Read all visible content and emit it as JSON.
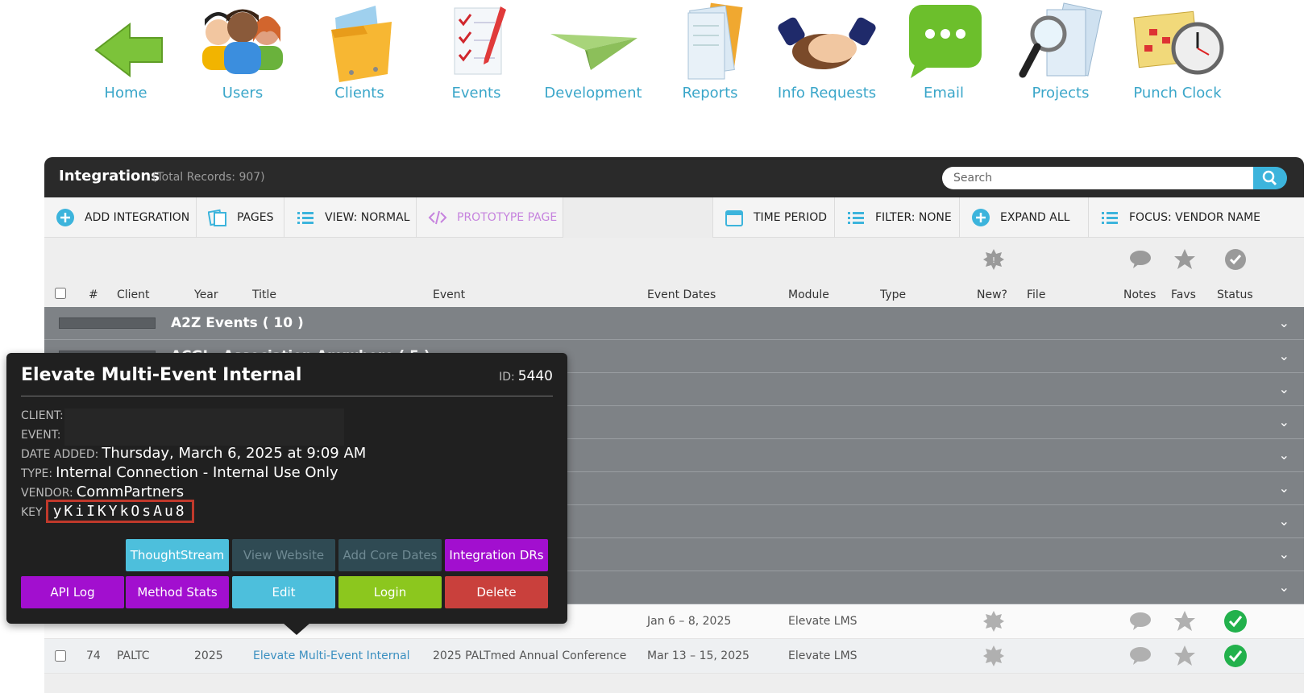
{
  "nav": [
    {
      "label": "Home",
      "icon": "home-arrow-icon"
    },
    {
      "label": "Users",
      "icon": "users-icon"
    },
    {
      "label": "Clients",
      "icon": "folder-icon"
    },
    {
      "label": "Events",
      "icon": "checklist-icon"
    },
    {
      "label": "Development",
      "icon": "paper-plane-icon"
    },
    {
      "label": "Reports",
      "icon": "documents-icon"
    },
    {
      "label": "Info Requests",
      "icon": "handshake-icon"
    },
    {
      "label": "Email",
      "icon": "chat-bubble-icon"
    },
    {
      "label": "Projects",
      "icon": "magnifier-icon"
    },
    {
      "label": "Punch Clock",
      "icon": "calendar-clock-icon"
    }
  ],
  "panel": {
    "title": "Integrations",
    "subtitle": "(Total Records: 907)",
    "search_placeholder": "Search"
  },
  "toolbar": {
    "add": "ADD INTEGRATION",
    "pages": "PAGES",
    "view": "VIEW: NORMAL",
    "prototype": "PROTOTYPE PAGE",
    "time": "TIME PERIOD",
    "filter": "FILTER: NONE",
    "expand": "EXPAND ALL",
    "focus": "FOCUS: VENDOR NAME"
  },
  "columns": {
    "num": "#",
    "client": "Client",
    "year": "Year",
    "title": "Title",
    "event": "Event",
    "dates": "Event Dates",
    "module": "Module",
    "type": "Type",
    "new": "New?",
    "file": "File",
    "notes": "Notes",
    "favs": "Favs",
    "status": "Status"
  },
  "groups": [
    {
      "name": "A2Z Events  ( 10 )"
    },
    {
      "name": "ACGI - Association Anywhere  ( 5 )"
    },
    {
      "name": ""
    },
    {
      "name": ""
    },
    {
      "name": ""
    },
    {
      "name": ""
    },
    {
      "name": ""
    },
    {
      "name": ""
    },
    {
      "name": ""
    }
  ],
  "rows": [
    {
      "num": "",
      "client": "",
      "year": "",
      "title": "",
      "event": "",
      "dates": "Jan 6 – 8, 2025",
      "module": "Elevate LMS"
    },
    {
      "num": "74",
      "client": "PALTC",
      "year": "2025",
      "title": "Elevate Multi-Event Internal",
      "event": "2025 PALTmed Annual Conference",
      "dates": "Mar 13 – 15, 2025",
      "module": "Elevate LMS"
    }
  ],
  "popover": {
    "title": "Elevate Multi-Event Internal",
    "id_label": "ID:",
    "id": "5440",
    "client_label": "CLIENT:",
    "event_label": "EVENT:",
    "date_label": "DATE ADDED:",
    "date": "Thursday, March 6, 2025 at 9:09 AM",
    "type_label": "TYPE:",
    "type": "Internal Connection - Internal Use Only",
    "vendor_label": "VENDOR:",
    "vendor": "CommPartners",
    "key_label": "KEY",
    "key": "yKiIKYkOsAu8",
    "buttons": {
      "thoughtstream": "ThoughtStream",
      "website": "View Website",
      "core_dates": "Add Core Dates",
      "drs": "Integration DRs",
      "api_log": "API Log",
      "method_stats": "Method Stats",
      "edit": "Edit",
      "login": "Login",
      "delete": "Delete"
    }
  },
  "colors": {
    "accent": "#3aa6c9",
    "purple": "#a20fcf",
    "green": "#8cc71e",
    "red": "#c9403c",
    "status_ok": "#22b14c"
  }
}
